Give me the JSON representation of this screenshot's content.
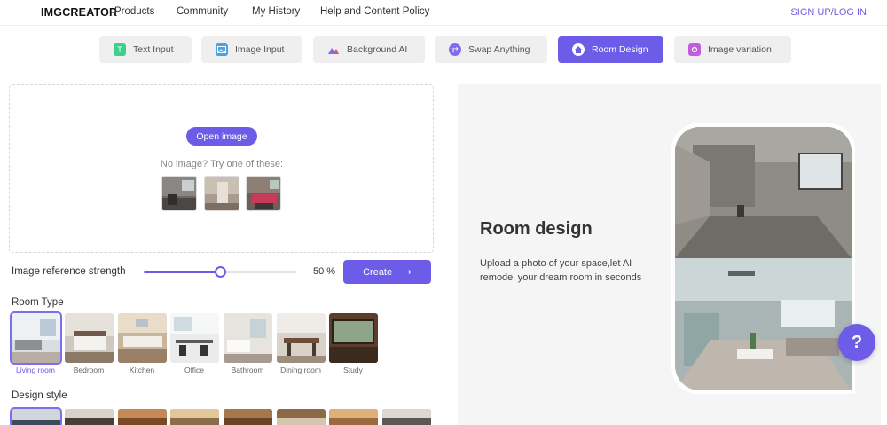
{
  "nav": {
    "logo": "IMGCREATOR",
    "links": [
      "Products",
      "Community",
      "My History",
      "Help and Content Policy"
    ],
    "signup": "SIGN UP/LOG IN"
  },
  "tabs": [
    {
      "label": "Text Input",
      "icon": "text-icon",
      "color": "#3ecf8e"
    },
    {
      "label": "Image Input",
      "icon": "image-icon",
      "color": "#4aa3df"
    },
    {
      "label": "Background AI",
      "icon": "mountain-icon",
      "color": "#7e6cf2"
    },
    {
      "label": "Swap Anything",
      "icon": "swap-icon",
      "color": "#7e6cf2"
    },
    {
      "label": "Room Design",
      "icon": "house-icon",
      "color": "#ffffff",
      "active": true
    },
    {
      "label": "Image variation",
      "icon": "variation-icon",
      "color": "#c15ee0"
    }
  ],
  "upload": {
    "open_label": "Open image",
    "hint": "No image? Try one of these:"
  },
  "strength": {
    "label": "Image reference strength",
    "value": 50,
    "display": "50 %"
  },
  "create_label": "Create",
  "create_arrow": "⟶",
  "room_type": {
    "title": "Room Type",
    "items": [
      "Living room",
      "Bedroom",
      "Kitchen",
      "Office",
      "Bathroom",
      "Dining room",
      "Study"
    ],
    "selected": "Living room"
  },
  "design_style": {
    "title": "Design style"
  },
  "hero": {
    "title": "Room design",
    "description": "Upload a photo of your space,let AI remodel your dream room in seconds"
  },
  "help_label": "?",
  "colors": {
    "accent": "#6c5ce7"
  }
}
